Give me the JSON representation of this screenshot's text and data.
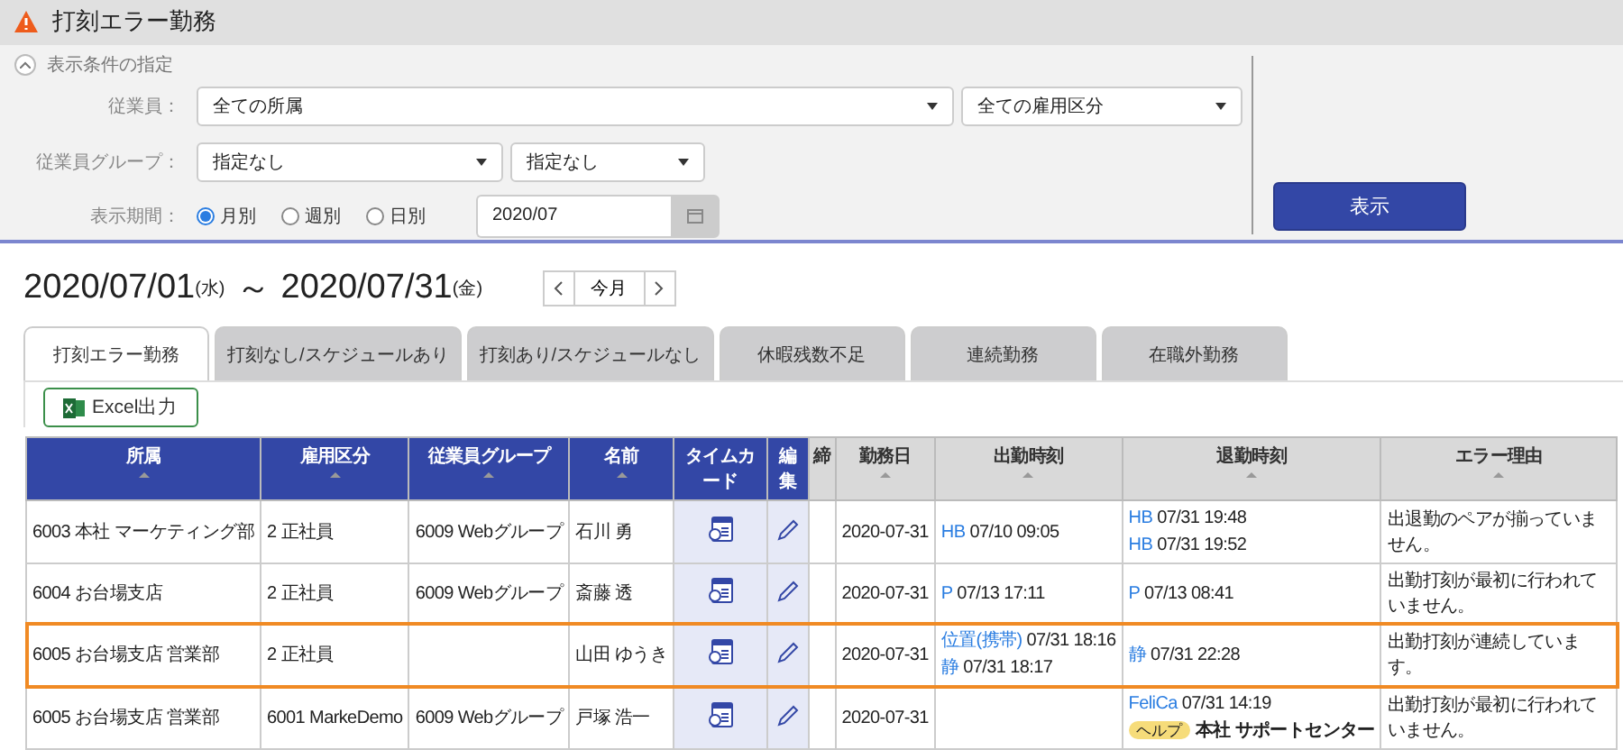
{
  "page": {
    "title": "打刻エラー勤務"
  },
  "filter": {
    "toggle_label": "表示条件の指定",
    "expanded": true,
    "fields": [
      {
        "label": "従業員：",
        "selects": [
          "全ての所属",
          "全ての雇用区分"
        ]
      },
      {
        "label": "従業員グループ：",
        "selects": [
          "指定なし",
          "指定なし"
        ]
      }
    ],
    "period": {
      "label": "表示期間：",
      "options": [
        {
          "label": "月別",
          "selected": true
        },
        {
          "label": "週別",
          "selected": false
        },
        {
          "label": "日別",
          "selected": false
        }
      ],
      "value": "2020/07"
    },
    "submit": "表示"
  },
  "range": {
    "start": "2020/07/01",
    "start_day": "(水)",
    "separator": "～",
    "end": "2020/07/31",
    "end_day": "(金)",
    "current": "今月"
  },
  "tabs": [
    {
      "label": "打刻エラー勤務",
      "selected": true
    },
    {
      "label": "打刻なし/スケジュールあり",
      "selected": false
    },
    {
      "label": "打刻あり/スケジュールなし",
      "selected": false
    },
    {
      "label": "休暇残数不足",
      "selected": false
    },
    {
      "label": "連続勤務",
      "selected": false
    },
    {
      "label": "在職外勤務",
      "selected": false
    }
  ],
  "export_button": "Excel出力",
  "table": {
    "columns": [
      {
        "label": "所属",
        "kind": "main",
        "sortable": true
      },
      {
        "label": "雇用区分",
        "kind": "main",
        "sortable": true
      },
      {
        "label": "従業員グループ",
        "kind": "main",
        "sortable": true
      },
      {
        "label": "名前",
        "kind": "main",
        "sortable": true
      },
      {
        "label": "タイムカード",
        "kind": "main",
        "sortable": false
      },
      {
        "label": "編集",
        "kind": "main",
        "sortable": false
      },
      {
        "label": "締",
        "kind": "sub",
        "sortable": false
      },
      {
        "label": "勤務日",
        "kind": "sub",
        "sortable": true
      },
      {
        "label": "出勤時刻",
        "kind": "sub",
        "sortable": true
      },
      {
        "label": "退勤時刻",
        "kind": "sub",
        "sortable": true
      },
      {
        "label": "エラー理由",
        "kind": "sub",
        "sortable": true
      }
    ],
    "rows": [
      {
        "selected": false,
        "dept": "6003 本社 マーケティング部",
        "employment": "2 正社員",
        "group": "6009 Webグループ",
        "name": "石川 勇",
        "date": "2020-07-31",
        "clock_in": [
          {
            "source": "HB",
            "time": "07/10 09:05"
          }
        ],
        "clock_out": [
          {
            "source": "HB",
            "time": "07/31 19:48"
          },
          {
            "source": "HB",
            "time": "07/31 19:52"
          }
        ],
        "error": "出退勤のペアが揃っていません。"
      },
      {
        "selected": false,
        "dept": "6004 お台場支店",
        "employment": "2 正社員",
        "group": "6009 Webグループ",
        "name": "斎藤 透",
        "date": "2020-07-31",
        "clock_in": [
          {
            "source": "P",
            "time": "07/13 17:11"
          }
        ],
        "clock_out": [
          {
            "source": "P",
            "time": "07/13 08:41"
          }
        ],
        "error": "出勤打刻が最初に行われていません。"
      },
      {
        "selected": true,
        "dept": "6005 お台場支店 営業部",
        "employment": "2 正社員",
        "name": "山田 ゆうき",
        "date": "2020-07-31",
        "clock_in": [
          {
            "source": "位置(携帯)",
            "time": "07/31 18:16"
          },
          {
            "source": "静",
            "time": "07/31 18:17"
          }
        ],
        "clock_out": [
          {
            "source": "静",
            "time": "07/31 22:28"
          }
        ],
        "error": "出勤打刻が連続しています。"
      },
      {
        "selected": false,
        "dept": "6005 お台場支店 営業部",
        "employment": "6001 MarkeDemo",
        "group": "6009 Webグループ",
        "name": "戸塚 浩一",
        "date": "2020-07-31",
        "clock_out": [
          {
            "source": "FeliCa",
            "time": "07/31 14:19"
          }
        ],
        "help": {
          "tag": "ヘルプ",
          "place": "本社 サポートセンター"
        },
        "error": "出勤打刻が最初に行われていません。"
      }
    ]
  }
}
